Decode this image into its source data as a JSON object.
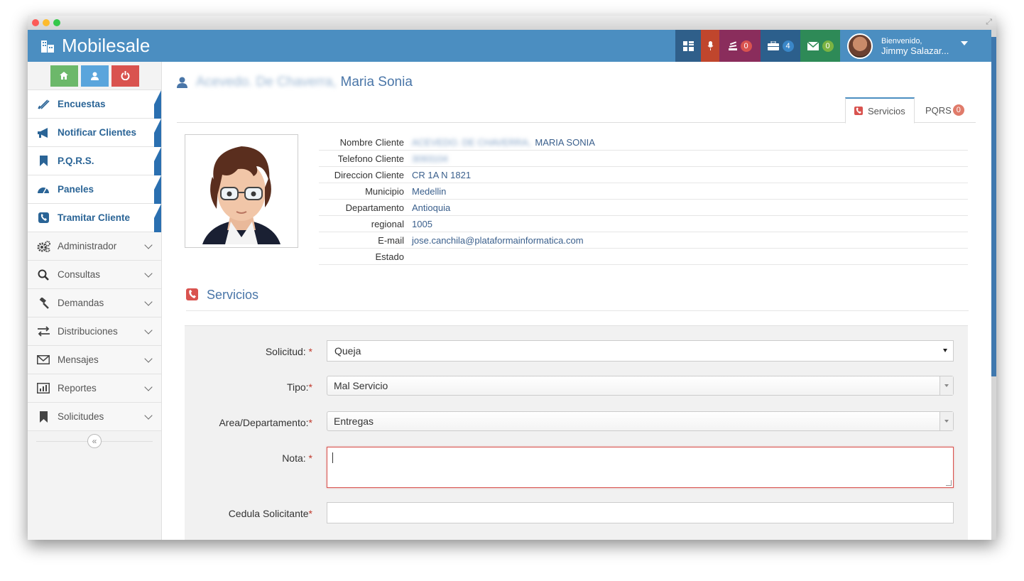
{
  "app": {
    "name": "Mobilesale"
  },
  "topbar": {
    "tools": [
      {
        "name": "grid",
        "icon": "grid-icon",
        "color": "#2f5f8a",
        "badge": null
      },
      {
        "name": "mic",
        "icon": "microphone-icon",
        "color": "#c0462d",
        "badge": null
      },
      {
        "name": "stack",
        "icon": "stack-icon",
        "color": "#8a2d5c",
        "badge": "0",
        "badge_color": "#d9534f"
      },
      {
        "name": "briefcase",
        "icon": "briefcase-icon",
        "color": "#2c5f8c",
        "badge": "4",
        "badge_color": "#3a87c8"
      },
      {
        "name": "mail",
        "icon": "envelope-icon",
        "color": "#2e8a57",
        "badge": "0",
        "badge_color": "#7cb342"
      }
    ],
    "user": {
      "greeting": "Bienvenido,",
      "name": "Jimmy Salazar..."
    }
  },
  "sidebar": {
    "shortcuts": [
      {
        "icon": "home-icon",
        "color": "#6cb86a"
      },
      {
        "icon": "user-icon",
        "color": "#5aa5dc"
      },
      {
        "icon": "power-icon",
        "color": "#d9534f"
      }
    ],
    "items": [
      {
        "label": "Encuestas",
        "icon": "pencil-icon",
        "active": true
      },
      {
        "label": "Notificar Clientes",
        "icon": "megaphone-icon",
        "active": true
      },
      {
        "label": "P.Q.R.S.",
        "icon": "bookmark-icon",
        "active": true
      },
      {
        "label": "Paneles",
        "icon": "dashboard-icon",
        "active": true
      },
      {
        "label": "Tramitar Cliente",
        "icon": "phone-icon",
        "active": true
      },
      {
        "label": "Administrador",
        "icon": "cogs-icon",
        "active": false
      },
      {
        "label": "Consultas",
        "icon": "search-icon",
        "active": false
      },
      {
        "label": "Demandas",
        "icon": "gavel-icon",
        "active": false
      },
      {
        "label": "Distribuciones",
        "icon": "transfer-icon",
        "active": false
      },
      {
        "label": "Mensajes",
        "icon": "envelope-icon",
        "active": false
      },
      {
        "label": "Reportes",
        "icon": "bar-chart-icon",
        "active": false
      },
      {
        "label": "Solicitudes",
        "icon": "bookmark-icon",
        "active": false
      }
    ],
    "collapse_glyph": "«"
  },
  "header": {
    "blurred_name": "Acevedo. De Chaverra,",
    "name": "Maria Sonia"
  },
  "tabs": [
    {
      "label": "Servicios",
      "badge": null
    },
    {
      "label": "PQRS",
      "badge": "0"
    }
  ],
  "client": {
    "rows": [
      {
        "key": "Nombre Cliente",
        "blurred": "ACEVEDO. DE CHAVERRA,",
        "value": "MARIA SONIA"
      },
      {
        "key": "Telefono Cliente",
        "blurred": "3093104",
        "value": ""
      },
      {
        "key": "Direccion Cliente",
        "blurred": "",
        "value": "CR 1A N 1821"
      },
      {
        "key": "Municipio",
        "blurred": "",
        "value": "Medellin"
      },
      {
        "key": "Departamento",
        "blurred": "",
        "value": "Antioquia"
      },
      {
        "key": "regional",
        "blurred": "",
        "value": "1005"
      },
      {
        "key": "E-mail",
        "blurred": "",
        "value": "jose.canchila@plataformainformatica.com"
      },
      {
        "key": "Estado",
        "blurred": "",
        "value": ""
      }
    ]
  },
  "section": {
    "title": "Servicios"
  },
  "form": {
    "solicitud": {
      "label": "Solicitud:",
      "value": "Queja"
    },
    "tipo": {
      "label": "Tipo:",
      "value": "Mal Servicio"
    },
    "area": {
      "label": "Area/Departamento:",
      "value": "Entregas"
    },
    "nota": {
      "label": "Nota:",
      "value": ""
    },
    "cedula": {
      "label": "Cedula Solicitante",
      "value": ""
    },
    "required_mark": "*"
  }
}
